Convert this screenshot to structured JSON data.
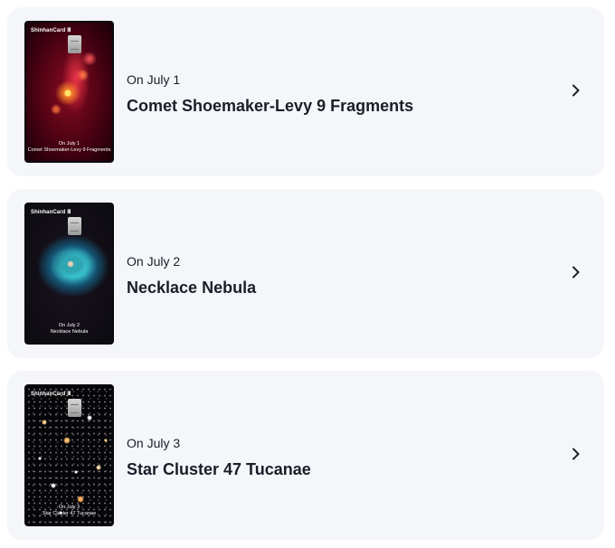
{
  "cards": [
    {
      "brand": "ShinhanCard",
      "brand_mark": "Ⅲ",
      "date_label": "On July 1",
      "title": "Comet Shoemaker-Levy 9 Fragments",
      "card_caption_date": "On July 1",
      "card_caption_title": "Comet Shoemaker-Levy 9 Fragments",
      "icon": "chevron-right-icon"
    },
    {
      "brand": "ShinhanCard",
      "brand_mark": "Ⅲ",
      "date_label": "On July 2",
      "title": "Necklace Nebula",
      "card_caption_date": "On July 2",
      "card_caption_title": "Necklace Nebula",
      "icon": "chevron-right-icon"
    },
    {
      "brand": "ShinhanCard",
      "brand_mark": "Ⅲ",
      "date_label": "On July 3",
      "title": "Star Cluster 47 Tucanae",
      "card_caption_date": "On July 3",
      "card_caption_title": "Star Cluster 47 Tucanae",
      "icon": "chevron-right-icon"
    }
  ],
  "colors": {
    "item_background": "#f4f6fa",
    "text": "#191f28"
  }
}
